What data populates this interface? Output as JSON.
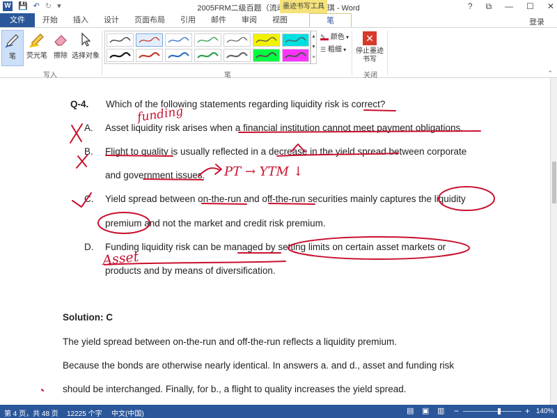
{
  "title_bar": {
    "document_title": "2005FRM二级百题（流动性风险）_周琪 - Word",
    "context_tab_title": "墨迹书写工具",
    "quick_access": [
      "W",
      "💾",
      "↶",
      "↻",
      "▾"
    ],
    "window_controls": [
      "?",
      "⧉",
      "—",
      "☐",
      "✕"
    ]
  },
  "tabs": [
    "文件",
    "开始",
    "插入",
    "设计",
    "页面布局",
    "引用",
    "邮件",
    "审阅",
    "视图",
    "笔"
  ],
  "login": "登录",
  "ribbon": {
    "write_tools": [
      {
        "label": "笔",
        "icon": "pen-icon"
      },
      {
        "label": "荧光笔",
        "icon": "highlighter-icon"
      },
      {
        "label": "擦除",
        "icon": "eraser-icon"
      },
      {
        "label": "选择对象",
        "icon": "select-cursor-icon"
      }
    ],
    "group_write_label": "写入",
    "group_pens_label": "笔",
    "color_label": "颜色",
    "thickness_label": "粗细",
    "stop_ink_label": "停止墨迹书写",
    "group_close_label": "关闭",
    "pen_colors": [
      "#333333",
      "#c0392b",
      "#2e6fbf",
      "#2e9e4a",
      "#666666",
      "#f2f200",
      "#00e0e0",
      "#111111",
      "#c0392b",
      "#2e6fbf",
      "#2e9e4a",
      "#666666",
      "#00ff40",
      "#ff33ff"
    ]
  },
  "document": {
    "question_label": "Q-4.",
    "question_text": "Which of the following statements regarding liquidity risk is correct?",
    "options": [
      {
        "letter": "A.",
        "lines": [
          "Asset liquidity risk arises when a financial institution cannot meet payment obligations."
        ]
      },
      {
        "letter": "B.",
        "lines": [
          "Flight to quality is usually reflected in a decrease in the yield spread between corporate",
          "and government issues."
        ]
      },
      {
        "letter": "C.",
        "lines": [
          "Yield spread between on-the-run and off-the-run securities mainly captures the liquidity",
          "premium and not the market and credit risk premium."
        ]
      },
      {
        "letter": "D.",
        "lines": [
          "Funding liquidity risk can be managed by setting limits on certain asset markets or",
          "products and by means of diversification."
        ]
      }
    ],
    "solution_label": "Solution: C",
    "solution_lines": [
      "The yield spread between on-the-run and off-the-run reflects a liquidity premium.",
      "Because the bonds are otherwise nearly identical. In answers a. and d., asset and funding risk",
      "should be interchanged. Finally, for b., a flight to quality increases the yield spread."
    ],
    "annotations": {
      "funding": "funding",
      "pt_ytm": "PT → YTM ↓",
      "asset": "Asset"
    },
    "ink_color": "#c8102e"
  },
  "status_bar": {
    "page": "第 4 页，共 48 页",
    "words": "12225 个字",
    "language": "中文(中国)",
    "zoom": "140%",
    "zoom_level_pct": 62
  }
}
